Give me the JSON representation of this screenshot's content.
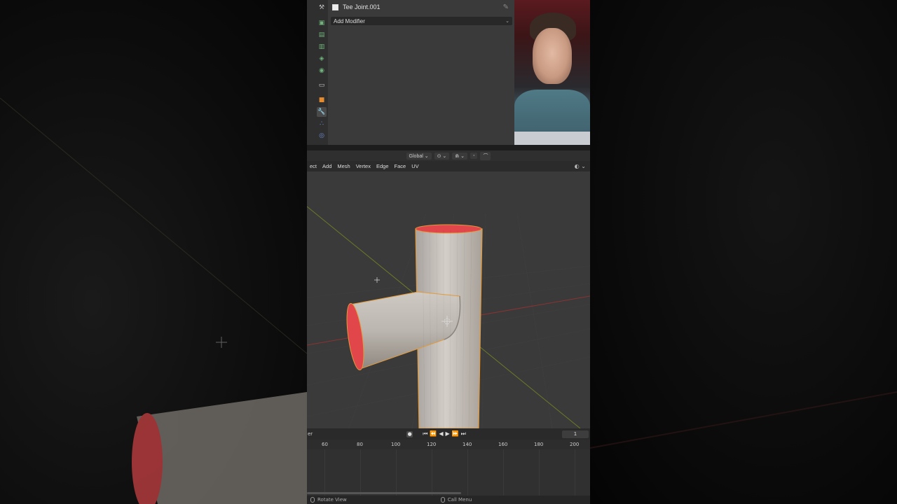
{
  "properties": {
    "object_name": "Tee Joint.001",
    "add_modifier_label": "Add Modifier",
    "tabs": [
      "tool-icon",
      "render-icon",
      "output-icon",
      "view-layer-icon",
      "scene-icon",
      "world-icon",
      "collection-icon",
      "object-icon",
      "modifier-icon",
      "particles-icon",
      "physics-icon"
    ]
  },
  "viewport_header": {
    "orientation": "Global"
  },
  "viewport_menu": {
    "items": [
      "ect",
      "Add",
      "Mesh",
      "Vertex",
      "Edge",
      "Face",
      "UV"
    ]
  },
  "timeline": {
    "left_label": "er",
    "current_frame": "1",
    "ticks": [
      "60",
      "80",
      "100",
      "120",
      "140",
      "160",
      "180",
      "200"
    ]
  },
  "status_bar": {
    "rotate_view": "Rotate View",
    "call_menu": "Call Menu"
  },
  "colors": {
    "mesh_surface": "#c8c3bd",
    "pipe_interior": "#e0464a",
    "selection_outline": "#e39a3c",
    "axis_x": "#a93a3a",
    "axis_y": "#7d8f2b"
  }
}
